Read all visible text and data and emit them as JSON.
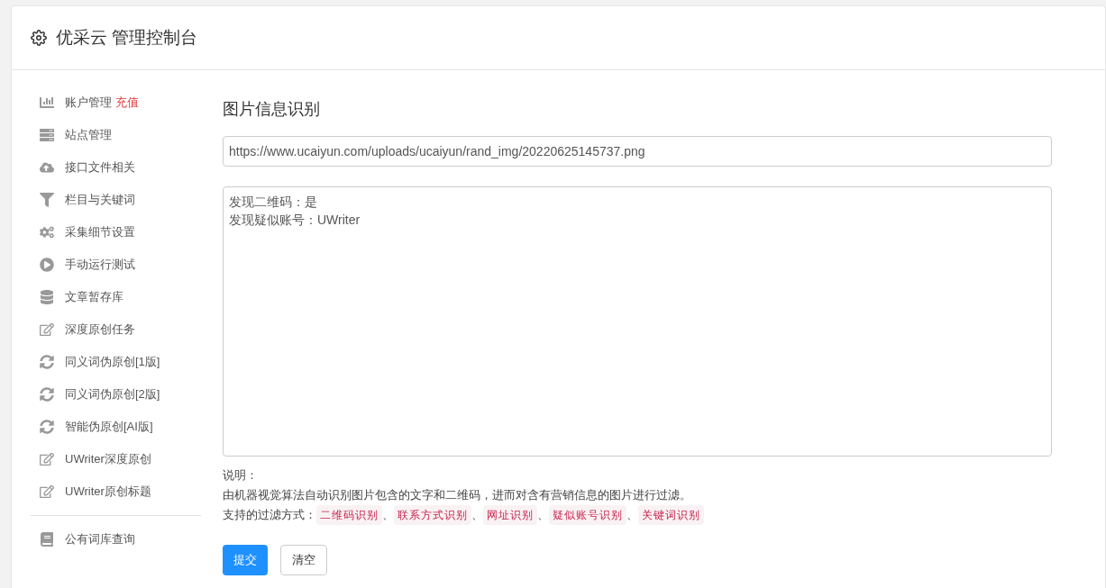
{
  "header": {
    "title": "优采云 管理控制台"
  },
  "sidebar": {
    "groups": [
      {
        "items": [
          {
            "label": "账户管理",
            "badge": "充值",
            "kind": "chart"
          },
          {
            "label": "站点管理",
            "kind": "server"
          },
          {
            "label": "接口文件相关",
            "kind": "cloud"
          },
          {
            "label": "栏目与关键词",
            "kind": "filter"
          },
          {
            "label": "采集细节设置",
            "kind": "cogs"
          },
          {
            "label": "手动运行测试",
            "kind": "play"
          },
          {
            "label": "文章暂存库",
            "kind": "database"
          },
          {
            "label": "深度原创任务",
            "kind": "edit"
          },
          {
            "label": "同义词伪原创[1版]",
            "kind": "sync"
          },
          {
            "label": "同义词伪原创[2版]",
            "kind": "sync"
          },
          {
            "label": "智能伪原创[AI版]",
            "kind": "sync"
          },
          {
            "label": "UWriter深度原创",
            "kind": "edit"
          },
          {
            "label": "UWriter原创标题",
            "kind": "edit"
          }
        ]
      },
      {
        "items": [
          {
            "label": "公有词库查询",
            "kind": "book"
          }
        ]
      }
    ]
  },
  "main": {
    "heading": "图片信息识别",
    "url_field": {
      "value": "https://www.ucaiyun.com/uploads/ucaiyun/rand_img/20220625145737.png"
    },
    "result_area": {
      "lines": [
        "发现二维码：是",
        "发现疑似账号：UWriter"
      ]
    },
    "notes_title": "说明：",
    "description": "由机器视觉算法自动识别图片包含的文字和二维码，进而对含有营销信息的图片进行过滤。",
    "filters_label": "支持的过滤方式：",
    "filters": [
      "二维码识别",
      "联系方式识别",
      "网址识别",
      "疑似账号识别",
      "关键词识别"
    ],
    "separator": "、",
    "buttons": [
      {
        "label": "提交",
        "kind": "primary"
      },
      {
        "label": "清空",
        "kind": "default"
      }
    ]
  }
}
